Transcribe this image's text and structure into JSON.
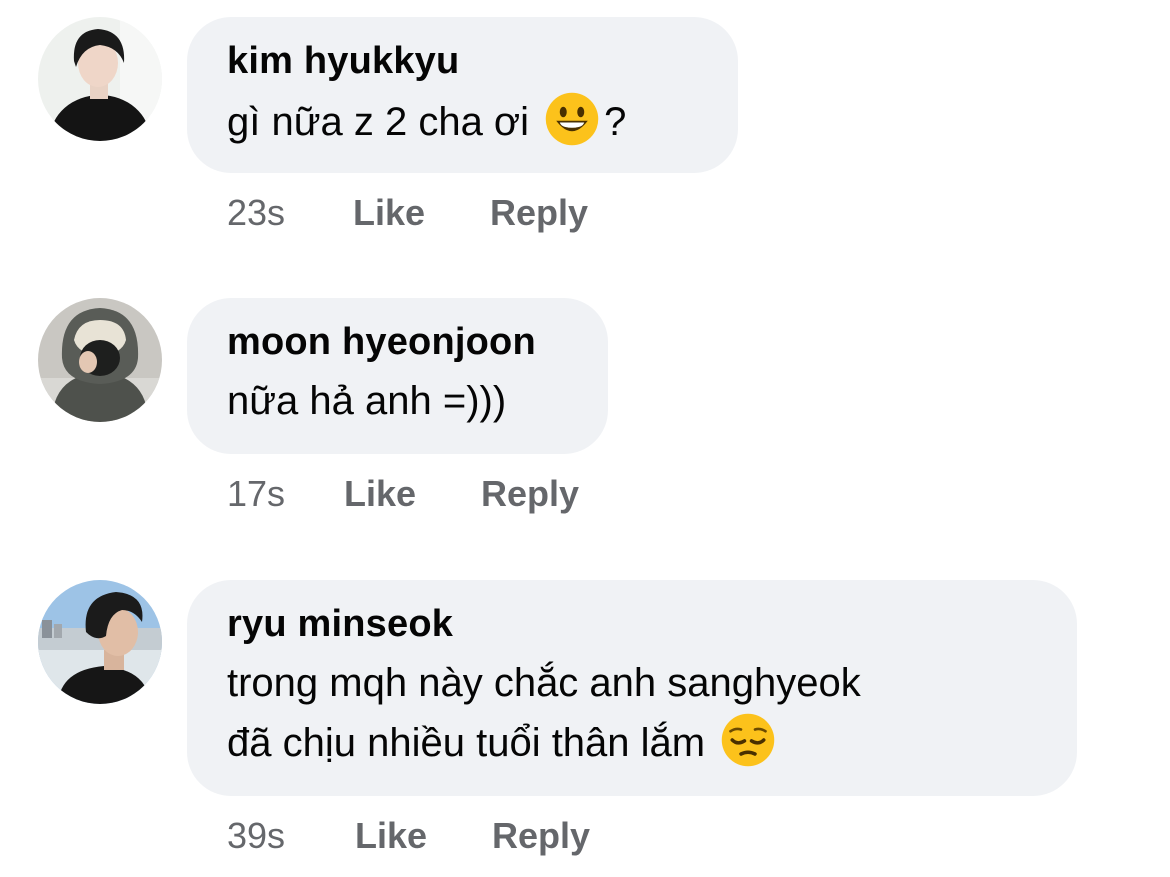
{
  "comments": [
    {
      "author": "kim hyukkyu",
      "text_before_emoji": "gì nữa z 2 cha ơi ",
      "emoji": "grinning-face",
      "text_after_emoji": "?",
      "time": "23s",
      "like_label": "Like",
      "reply_label": "Reply"
    },
    {
      "author": "moon hyeonjoon",
      "text": "nữa hả anh =)))",
      "time": "17s",
      "like_label": "Like",
      "reply_label": "Reply"
    },
    {
      "author": "ryu minseok",
      "text_line1": "trong mqh này chắc anh sanghyeok",
      "text_line2_before_emoji": "đã chịu nhiều tuổi thân lắm ",
      "emoji": "pensive-face",
      "time": "39s",
      "like_label": "Like",
      "reply_label": "Reply"
    }
  ],
  "colors": {
    "bubble_bg": "#f0f2f5",
    "meta_text": "#65676b",
    "primary_text": "#050505",
    "emoji_yellow": "#fcc21b"
  }
}
